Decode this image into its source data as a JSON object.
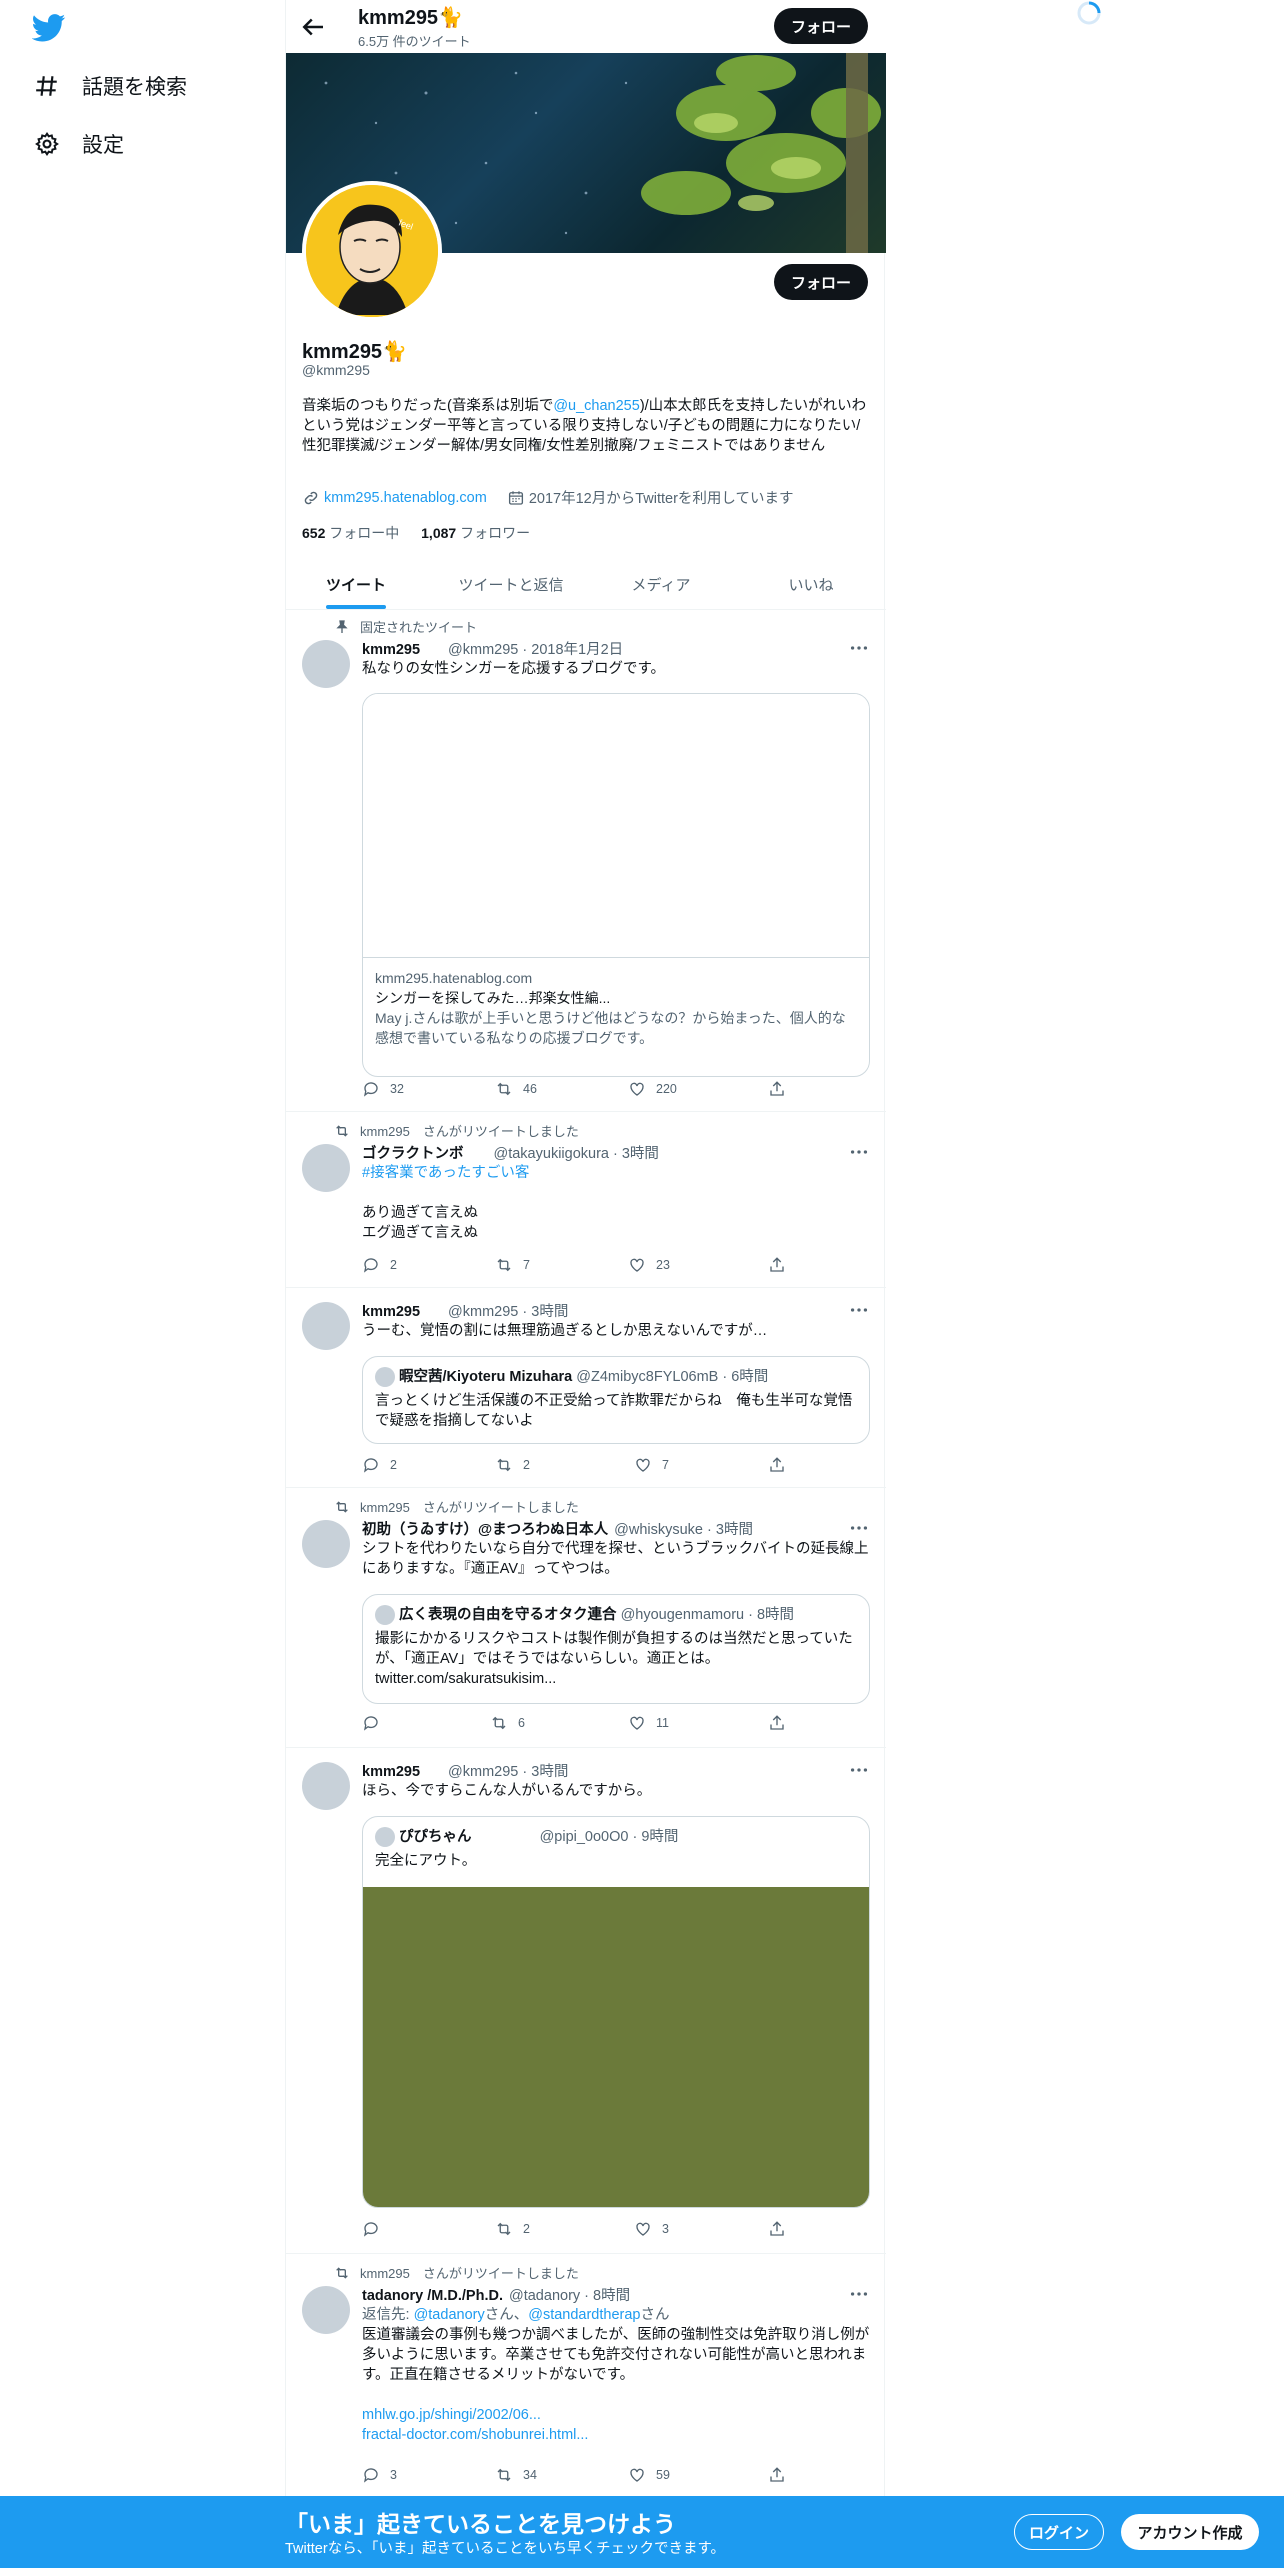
{
  "nav": {
    "items": [
      {
        "label": "話題を検索",
        "icon": "hashtag-icon"
      },
      {
        "label": "設定",
        "icon": "gear-icon"
      }
    ]
  },
  "header": {
    "title": "kmm295🐈",
    "tweet_count": "6.5万 件のツイート",
    "follow_label": "フォロー"
  },
  "profile": {
    "name": "kmm295🐈",
    "handle": "@kmm295",
    "follow_label": "フォロー",
    "bio_pre": "音楽垢のつもりだった(音楽系は別垢で",
    "bio_mention": "@u_chan255",
    "bio_post": ")/山本太郎氏を支持したいがれいわという党はジェンダー平等と言っている限り支持しない/子どもの問題に力になりたい/性犯罪撲滅/ジェンダー解体/男女同権/女性差別撤廃/フェミニストではありません",
    "website": "kmm295.hatenablog.com",
    "joined": "2017年12月からTwitterを利用しています",
    "following_count": "652",
    "following_label": "フォロー中",
    "followers_count": "1,087",
    "followers_label": "フォロワー"
  },
  "tabs": [
    "ツイート",
    "ツイートと返信",
    "メディア",
    "いいね"
  ],
  "tweets": {
    "t1": {
      "context": "固定されたツイート",
      "name": "kmm295",
      "meta": "@kmm295 · 2018年1月2日",
      "text": "私なりの女性シンガーを応援するブログです。",
      "card_domain": "kmm295.hatenablog.com",
      "card_title": "シンガーを探してみた…邦楽女性編...",
      "card_desc": "May j.さんは歌が上手いと思うけど他はどうなの？から始まった、個人的な感想で書いている私なりの応援ブログです。",
      "replies": "32",
      "retweets": "46",
      "likes": "220"
    },
    "t2": {
      "context": "kmm295　さんがリツイートしました",
      "name": "ゴクラクトンボ",
      "meta": "@takayukiigokura · 3時間",
      "hashtag": "#接客業であったすごい客",
      "line1": "あり過ぎて言えぬ",
      "line2": "エグ過ぎて言えぬ",
      "replies": "2",
      "retweets": "7",
      "likes": "23"
    },
    "t3": {
      "name": "kmm295",
      "meta": "@kmm295 · 3時間",
      "text": "うーむ、覚悟の割には無理筋過ぎるとしか思えないんですが…",
      "q_name": "暇空茜/Kiyoteru Mizuhara",
      "q_meta": "@Z4mibyc8FYL06mB · 6時間",
      "q_text": "言っとくけど生活保護の不正受給って詐欺罪だからね　俺も生半可な覚悟で疑惑を指摘してないよ",
      "replies": "2",
      "retweets": "2",
      "likes": "7"
    },
    "t4": {
      "context": "kmm295　さんがリツイートしました",
      "name": "初助（うゐすけ）@まつろわぬ日本人",
      "meta": "@whiskysuke · 3時間",
      "text": "シフトを代わりたいなら自分で代理を探せ、というブラックバイトの延長線上にありますな。『適正AV』ってやつは。",
      "q_name": "広く表現の自由を守るオタク連合",
      "q_meta": "@hyougenmamoru · 8時間",
      "q_text": "撮影にかかるリスクやコストは製作側が負担するのは当然だと思っていたが、「適正AV」ではそうではないらしい。適正とは。",
      "q_link": "twitter.com/sakuratsukisim...",
      "replies": "",
      "retweets": "6",
      "likes": "11"
    },
    "t5": {
      "name": "kmm295",
      "meta": "@kmm295 · 3時間",
      "text": "ほら、今ですらこんな人がいるんですから。",
      "q_name": "ぴぴちゃん",
      "q_meta": "@pipi_0o0O0 · 9時間",
      "q_text": "完全にアウト。",
      "replies": "",
      "retweets": "2",
      "likes": "3"
    },
    "t6": {
      "context": "kmm295　さんがリツイートしました",
      "name": "tadanory /M.D./Ph.D.",
      "meta": "@tadanory · 8時間",
      "reply_prefix": "返信先:",
      "reply_to1": "@tadanory",
      "reply_mid": "さん、",
      "reply_to2": "@standardtherap",
      "reply_suffix": "さん",
      "text": "医道審議会の事例も幾つか調べましたが、医師の強制性交は免許取り消し例が多いように思います。卒業させても免許交付されない可能性が高いと思われます。正直在籍させるメリットがないです。",
      "link1": "mhlw.go.jp/shingi/2002/06...",
      "link2": "fractal-doctor.com/shobunrei.html...",
      "replies": "3",
      "retweets": "34",
      "likes": "59"
    }
  },
  "bottom": {
    "title": "「いま」起きていることを見つけよう",
    "subtitle": "Twitterなら、「いま」起きていることをいち早くチェックできます。",
    "login": "ログイン",
    "signup": "アカウント作成"
  },
  "colors": {
    "accent": "#1d9bf0",
    "text": "#0f1419",
    "muted": "#536471",
    "media_olive": "#6b7a3a"
  }
}
